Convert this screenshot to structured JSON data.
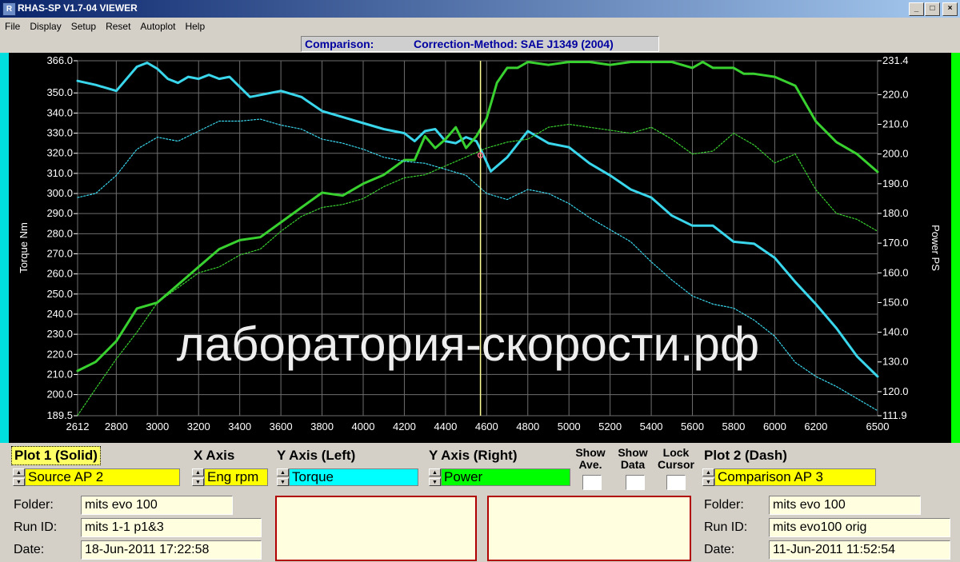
{
  "window": {
    "title": "RHAS-SP V1.7-04  VIEWER"
  },
  "menu": [
    "File",
    "Display",
    "Setup",
    "Reset",
    "Autoplot",
    "Help"
  ],
  "info": {
    "label": "Comparison:",
    "method": "Correction-Method: SAE J1349 (2004)"
  },
  "watermark": "лаборатория-скорости.рф",
  "chart_data": {
    "type": "line",
    "xlabel": "",
    "ylabel_left": "Torque Nm",
    "ylabel_right": "Power PS",
    "x_ticks": [
      "2612",
      "2800",
      "3000",
      "3200",
      "3400",
      "3600",
      "3800",
      "4000",
      "4200",
      "4400",
      "4600",
      "4800",
      "5000",
      "5200",
      "5400",
      "5600",
      "5800",
      "6000",
      "6200",
      "6500"
    ],
    "y_left_ticks": [
      "366.0",
      "350.0",
      "340.0",
      "330.0",
      "320.0",
      "310.0",
      "300.0",
      "290.0",
      "280.0",
      "270.0",
      "260.0",
      "250.0",
      "240.0",
      "230.0",
      "220.0",
      "210.0",
      "200.0",
      "189.5"
    ],
    "y_right_ticks": [
      "231.4",
      "220.0",
      "210.0",
      "200.0",
      "190.0",
      "180.0",
      "170.0",
      "160.0",
      "150.0",
      "140.0",
      "130.0",
      "120.0",
      "111.9"
    ],
    "xlim": [
      2612,
      6500
    ],
    "ylim_left": [
      189.5,
      366.0
    ],
    "ylim_right": [
      111.9,
      231.4
    ],
    "cursor_x": 4570,
    "grid": true,
    "series": [
      {
        "name": "Torque",
        "axis": "left",
        "style": "solid",
        "color": "#3ad6ec",
        "x": [
          2612,
          2700,
          2800,
          2900,
          2950,
          3000,
          3050,
          3100,
          3150,
          3200,
          3250,
          3300,
          3350,
          3400,
          3450,
          3500,
          3600,
          3700,
          3800,
          3900,
          4000,
          4100,
          4200,
          4250,
          4300,
          4350,
          4400,
          4450,
          4500,
          4550,
          4580,
          4620,
          4700,
          4800,
          4900,
          5000,
          5100,
          5200,
          5300,
          5400,
          5500,
          5600,
          5700,
          5800,
          5900,
          6000,
          6100,
          6200,
          6300,
          6400,
          6500
        ],
        "y": [
          356,
          354,
          351,
          363,
          365,
          362,
          357,
          355,
          358,
          357,
          359,
          357,
          358,
          353,
          348,
          349,
          351,
          348,
          341,
          338,
          335,
          332,
          330,
          326,
          331,
          332,
          326,
          325,
          328,
          326,
          320,
          311,
          318,
          331,
          325,
          323,
          315,
          309,
          302,
          298,
          289,
          284,
          284,
          276,
          275,
          268,
          256,
          245,
          233,
          219,
          209
        ]
      },
      {
        "name": "Power",
        "axis": "right",
        "style": "solid",
        "color": "#39d12f",
        "x": [
          2612,
          2700,
          2800,
          2900,
          3000,
          3100,
          3200,
          3300,
          3400,
          3500,
          3600,
          3700,
          3800,
          3900,
          4000,
          4100,
          4200,
          4250,
          4300,
          4350,
          4400,
          4450,
          4500,
          4550,
          4600,
          4650,
          4700,
          4750,
          4800,
          4900,
          5000,
          5100,
          5200,
          5300,
          5400,
          5500,
          5600,
          5650,
          5700,
          5750,
          5800,
          5850,
          5900,
          6000,
          6100,
          6200,
          6300,
          6400,
          6500
        ],
        "y": [
          127,
          130,
          137,
          148,
          150,
          156,
          162,
          168,
          171,
          172,
          177,
          182,
          187,
          186,
          190,
          193,
          198,
          198,
          206,
          202,
          205,
          209,
          202,
          206,
          212,
          224,
          229,
          229,
          231,
          230,
          231,
          231,
          230,
          231,
          231,
          231,
          229,
          231,
          229,
          229,
          229,
          227,
          227,
          226,
          223,
          211,
          204,
          200,
          194
        ]
      },
      {
        "name": "Torque (Comparison)",
        "axis": "left",
        "style": "dash",
        "color": "#3ad6ec",
        "x": [
          2612,
          2700,
          2800,
          2900,
          3000,
          3100,
          3200,
          3300,
          3400,
          3500,
          3600,
          3700,
          3800,
          3900,
          4000,
          4100,
          4200,
          4300,
          4400,
          4500,
          4600,
          4700,
          4800,
          4900,
          5000,
          5100,
          5200,
          5300,
          5400,
          5500,
          5600,
          5700,
          5800,
          5900,
          6000,
          6100,
          6200,
          6300,
          6400,
          6500
        ],
        "y": [
          298,
          300,
          309,
          322,
          328,
          326,
          331,
          336,
          336,
          337,
          334,
          332,
          327,
          325,
          322,
          318,
          316,
          315,
          312,
          309,
          300,
          297,
          302,
          300,
          295,
          288,
          282,
          276,
          266,
          257,
          249,
          245,
          243,
          237,
          229,
          216,
          209,
          204,
          198,
          192
        ]
      },
      {
        "name": "Power (Comparison)",
        "axis": "right",
        "style": "dash",
        "color": "#39d12f",
        "x": [
          2612,
          2700,
          2800,
          2900,
          3000,
          3100,
          3200,
          3300,
          3400,
          3500,
          3600,
          3700,
          3800,
          3900,
          4000,
          4100,
          4200,
          4300,
          4400,
          4500,
          4600,
          4700,
          4800,
          4900,
          5000,
          5100,
          5200,
          5300,
          5400,
          5500,
          5600,
          5700,
          5800,
          5900,
          6000,
          6100,
          6200,
          6300,
          6400,
          6500
        ],
        "y": [
          112,
          121,
          131,
          140,
          150,
          155,
          160,
          162,
          166,
          168,
          174,
          179,
          182,
          183,
          185,
          189,
          192,
          193,
          196,
          199,
          202,
          204,
          205,
          209,
          210,
          209,
          208,
          207,
          209,
          205,
          200,
          201,
          207,
          203,
          197,
          200,
          188,
          180,
          178,
          174
        ]
      }
    ]
  },
  "controls": {
    "plot1_label": "Plot 1 (Solid)",
    "plot1_value": "Source AP 2",
    "xaxis_label": "X Axis",
    "xaxis_value": "Eng rpm",
    "yleft_label": "Y Axis (Left)",
    "yleft_value": "Torque",
    "yright_label": "Y Axis (Right)",
    "yright_value": "Power",
    "show_ave_1": "Show",
    "show_ave_2": "Ave.",
    "show_data_1": "Show",
    "show_data_2": "Data",
    "lock_cursor_1": "Lock",
    "lock_cursor_2": "Cursor",
    "plot2_label": "Plot 2 (Dash)",
    "plot2_value": "Comparison AP 3"
  },
  "left_panel": {
    "folder_label": "Folder:",
    "folder_value": "mits evo 100",
    "runid_label": "Run ID:",
    "runid_value": "mits 1-1 p1&3",
    "date_label": "Date:",
    "date_value": "18-Jun-2011  17:22:58"
  },
  "right_panel": {
    "folder_label": "Folder:",
    "folder_value": "mits evo 100",
    "runid_label": "Run ID:",
    "runid_value": "mits evo100 orig",
    "date_label": "Date:",
    "date_value": "11-Jun-2011  11:52:54"
  },
  "colors": {
    "torque": "#3ad6ec",
    "power": "#39d12f",
    "plot_bg": "#000000",
    "grid": "#6e6e6e",
    "cursor": "#ffff99"
  }
}
